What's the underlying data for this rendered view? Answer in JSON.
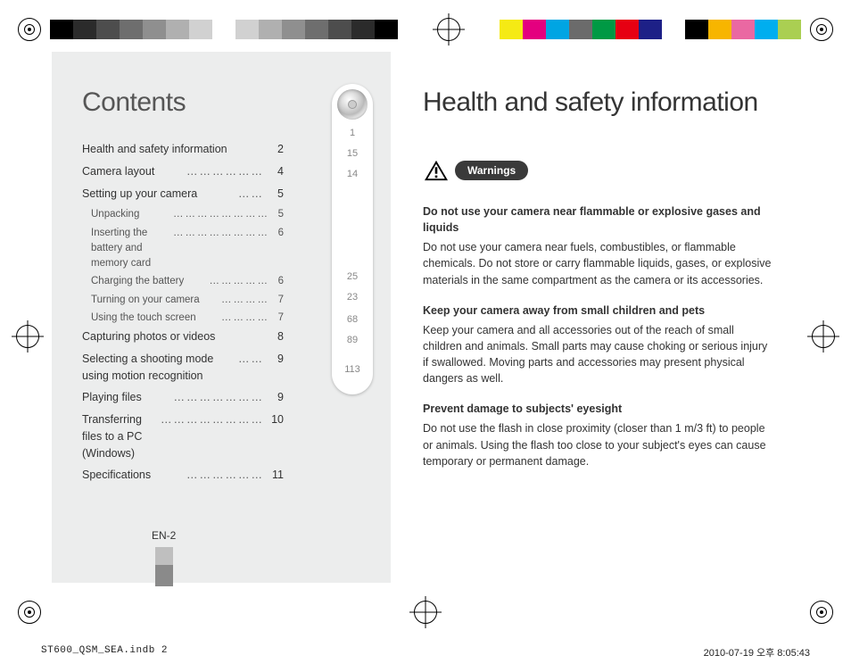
{
  "contents_title": "Contents",
  "right_title": "Health and safety information",
  "toc": [
    {
      "label": "Health and safety information",
      "page": "2",
      "disc": "1"
    },
    {
      "label": "Camera layout",
      "dots": "………………",
      "page": "4",
      "disc": "15"
    },
    {
      "label": "Setting up your camera",
      "dots": "……",
      "page": "5",
      "disc": "14",
      "sub": [
        {
          "label": "Unpacking",
          "dots": "……………………",
          "page": "5"
        },
        {
          "label": "Inserting the battery and memory card",
          "dots": "……………………",
          "page": "6"
        },
        {
          "label": "Charging the battery",
          "dots": "……………",
          "page": "6"
        },
        {
          "label": "Turning on your camera",
          "dots": "…………",
          "page": "7"
        },
        {
          "label": "Using the touch screen",
          "dots": "…………",
          "page": "7"
        }
      ]
    },
    {
      "label": "Capturing photos or videos",
      "page": "8",
      "disc": "25"
    },
    {
      "label": "Selecting a shooting mode using motion recognition",
      "dots": "……",
      "page": "9",
      "disc": "23"
    },
    {
      "label": "Playing files",
      "dots": "…………………",
      "page": "9",
      "disc": "68"
    },
    {
      "label": "Transferring files to a PC (Windows)",
      "dots": "……………………",
      "page": "10",
      "disc": "89"
    },
    {
      "label": "Specifications",
      "dots": "………………",
      "page": "11",
      "disc": "113"
    }
  ],
  "page_label": "EN-2",
  "warnings_label": "Warnings",
  "sections": [
    {
      "heading": "Do not use your camera near flammable or explosive gases and liquids",
      "body": "Do not use your camera near fuels, combustibles, or flammable chemicals. Do not store or carry flammable liquids, gases, or explosive materials in the same compartment as the camera or its accessories."
    },
    {
      "heading": "Keep your camera away from small children and pets",
      "body": "Keep your camera and all accessories out of the reach of small children and animals. Small parts may cause choking or serious injury if swallowed. Moving parts and accessories may present physical dangers as well."
    },
    {
      "heading": "Prevent damage to subjects' eyesight",
      "body": "Do not use the flash in close proximity (closer than 1 m/3 ft) to people or animals. Using the flash too close to your subject's eyes can cause temporary or permanent damage."
    }
  ],
  "footer": {
    "file": "ST600_QSM_SEA.indb   2",
    "stamp": "2010-07-19   오후 8:05:43"
  },
  "gray_swatches": [
    "#000000",
    "#2b2b2b",
    "#4d4d4d",
    "#6e6e6e",
    "#8f8f8f",
    "#b0b0b0",
    "#d1d1d1",
    "#ffffff",
    "#d1d1d1",
    "#b0b0b0",
    "#8f8f8f",
    "#6e6e6e",
    "#4d4d4d",
    "#2b2b2b",
    "#000000"
  ],
  "color_swatches": [
    "#f5ea14",
    "#e4007f",
    "#00a5e3",
    "#6b6b6b",
    "#009944",
    "#e60012",
    "#1d2087",
    "#ffffff",
    "#000000",
    "#f7b500",
    "#ea68a2",
    "#00aeef",
    "#aacf52"
  ]
}
